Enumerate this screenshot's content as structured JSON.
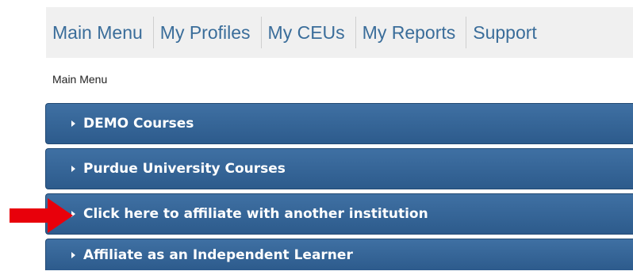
{
  "nav": {
    "items": [
      "Main Menu",
      "My Profiles",
      "My CEUs",
      "My Reports",
      "Support"
    ]
  },
  "breadcrumb": "Main Menu",
  "menu": {
    "items": [
      {
        "label": "DEMO Courses"
      },
      {
        "label": "Purdue University Courses"
      },
      {
        "label": "Click here to affiliate with another institution"
      },
      {
        "label": "Affiliate as an Independent Learner"
      }
    ]
  },
  "colors": {
    "nav_text": "#3a6d9a",
    "bar": "#2f5d8e",
    "arrow": "#e8000b"
  },
  "icons": {
    "caret": "caret-right-icon",
    "pointer": "red-arrow-icon"
  }
}
